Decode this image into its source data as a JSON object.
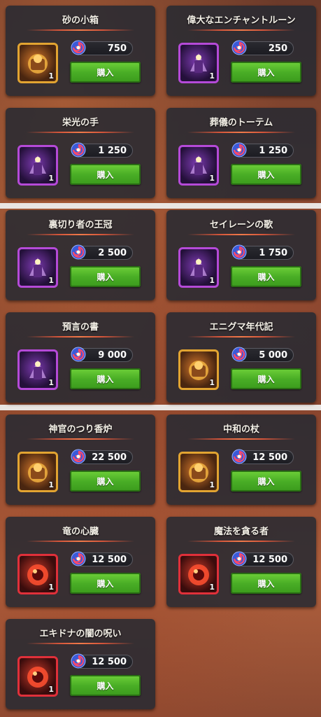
{
  "buy_label": "購入",
  "currency_icon": "swirl-gem-icon",
  "cards": [
    {
      "title": "砂の小箱",
      "price": "750",
      "qty": "1",
      "frame": "gold",
      "icon": "sand-box-icon"
    },
    {
      "title": "偉大なエンチャントルーン",
      "price": "250",
      "qty": "1",
      "frame": "purple",
      "icon": "enchant-rune-icon"
    },
    {
      "title": "栄光の手",
      "price": "1 250",
      "qty": "1",
      "frame": "purple",
      "icon": "candle-hand-icon"
    },
    {
      "title": "葬儀のトーテム",
      "price": "1 250",
      "qty": "1",
      "frame": "purple",
      "icon": "totem-icon"
    },
    {
      "title": "裏切り者の王冠",
      "price": "2 500",
      "qty": "1",
      "frame": "purple",
      "icon": "crown-icon"
    },
    {
      "title": "セイレーンの歌",
      "price": "1 750",
      "qty": "1",
      "frame": "purple",
      "icon": "flute-icon"
    },
    {
      "title": "預言の書",
      "price": "9 000",
      "qty": "1",
      "frame": "purple",
      "icon": "prophecy-book-icon"
    },
    {
      "title": "エニグマ年代記",
      "price": "5 000",
      "qty": "1",
      "frame": "gold",
      "icon": "scroll-icon"
    },
    {
      "title": "神官のつり香炉",
      "price": "22 500",
      "qty": "1",
      "frame": "gold",
      "icon": "censer-icon"
    },
    {
      "title": "中和の杖",
      "price": "12 500",
      "qty": "1",
      "frame": "gold",
      "icon": "staff-icon"
    },
    {
      "title": "竜の心臓",
      "price": "12 500",
      "qty": "1",
      "frame": "red",
      "icon": "dragon-heart-icon"
    },
    {
      "title": "魔法を貪る者",
      "price": "12 500",
      "qty": "1",
      "frame": "red",
      "icon": "magic-devourer-icon"
    },
    {
      "title": "エキドナの闇の呪い",
      "price": "12 500",
      "qty": "1",
      "frame": "red",
      "icon": "dark-curse-icon"
    }
  ],
  "colors": {
    "gold_frame": "#e2a431",
    "purple_frame": "#b54ad8",
    "red_frame": "#e0303a",
    "buy_green": "#4aae26"
  }
}
